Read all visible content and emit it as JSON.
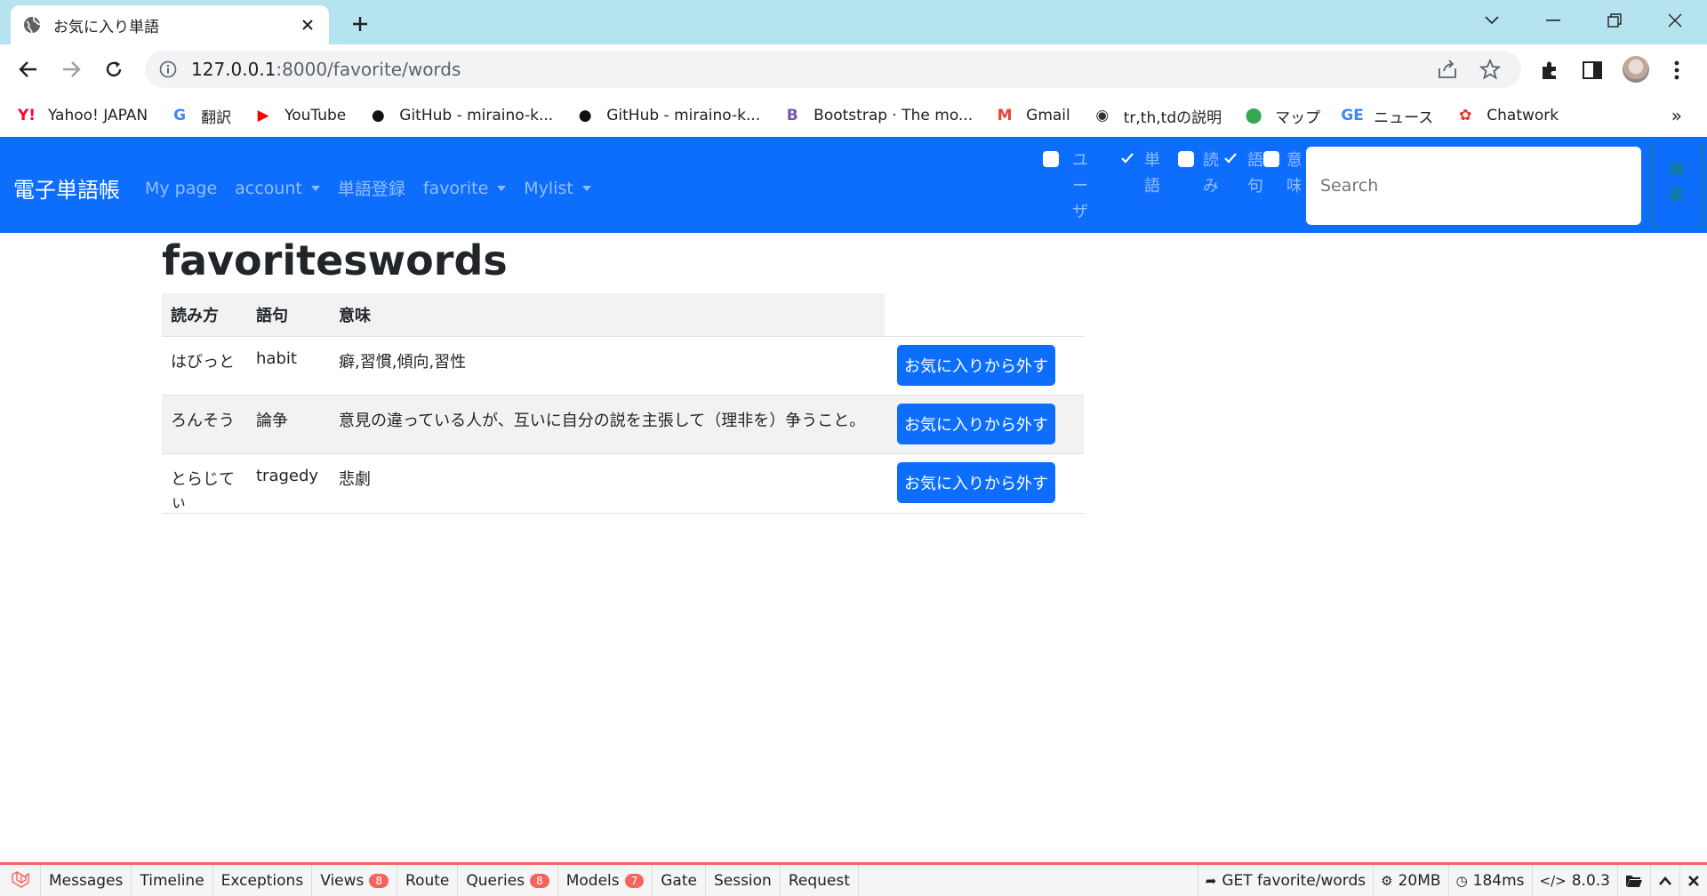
{
  "browser": {
    "tab_title": "お気に入り単語",
    "url_host": "127.0.0.1",
    "url_path": ":8000/favorite/words"
  },
  "bookmarks": [
    {
      "label": "Yahoo! JAPAN",
      "icon": "yahoo-icon",
      "glyph": "Y!",
      "color": "#ff0033"
    },
    {
      "label": "翻訳",
      "icon": "translate-icon",
      "glyph": "G",
      "color": "#4285f4"
    },
    {
      "label": "YouTube",
      "icon": "youtube-icon",
      "glyph": "▶",
      "color": "#ff0000"
    },
    {
      "label": "GitHub - miraino-k...",
      "icon": "github-icon",
      "glyph": "●",
      "color": "#111111"
    },
    {
      "label": "GitHub - miraino-k...",
      "icon": "github-icon",
      "glyph": "●",
      "color": "#111111"
    },
    {
      "label": "Bootstrap · The mo...",
      "icon": "bootstrap-icon",
      "glyph": "B",
      "color": "#7952b3"
    },
    {
      "label": "Gmail",
      "icon": "gmail-icon",
      "glyph": "M",
      "color": "#ea4335"
    },
    {
      "label": "tr,th,tdの説明",
      "icon": "globe-icon",
      "glyph": "◉",
      "color": "#333333"
    },
    {
      "label": "マップ",
      "icon": "maps-icon",
      "glyph": "⬤",
      "color": "#34a853"
    },
    {
      "label": "ニュース",
      "icon": "news-icon",
      "glyph": "GE",
      "color": "#4285f4"
    },
    {
      "label": "Chatwork",
      "icon": "chatwork-icon",
      "glyph": "✿",
      "color": "#e6332a"
    }
  ],
  "navbar": {
    "brand": "電子単語帳",
    "links": [
      "My page",
      "account",
      "単語登録",
      "favorite",
      "Mylist"
    ],
    "filters": {
      "user": {
        "label": "ユーザー名",
        "checked": false
      },
      "word": {
        "label": "単語",
        "checked": true
      },
      "reading": {
        "label": "読み",
        "checked": false
      },
      "phrase": {
        "label": "語句",
        "checked": true
      },
      "meaning": {
        "label": "意味",
        "checked": false
      }
    },
    "search_placeholder": "Search",
    "search_button": "検索"
  },
  "main": {
    "title": "favoriteswords",
    "columns": [
      "読み方",
      "語句",
      "意味"
    ],
    "rows": [
      {
        "reading": "はびっと",
        "phrase": "habit",
        "meaning": "癖,習慣,傾向,習性",
        "action": "お気に入りから外す"
      },
      {
        "reading": "ろんそう",
        "phrase": "論争",
        "meaning": "意見の違っている人が、互いに自分の説を主張して（理非を）争うこと。",
        "action": "お気に入りから外す"
      },
      {
        "reading": "とらじてぃ",
        "phrase": "tragedy",
        "meaning": "悲劇",
        "action": "お気に入りから外す"
      }
    ]
  },
  "debugbar": {
    "tabs": [
      {
        "label": "Messages"
      },
      {
        "label": "Timeline"
      },
      {
        "label": "Exceptions"
      },
      {
        "label": "Views",
        "badge": "8"
      },
      {
        "label": "Route"
      },
      {
        "label": "Queries",
        "badge": "8"
      },
      {
        "label": "Models",
        "badge": "7"
      },
      {
        "label": "Gate"
      },
      {
        "label": "Session"
      },
      {
        "label": "Request"
      }
    ],
    "route": "GET favorite/words",
    "memory": "20MB",
    "time": "184ms",
    "php_version": "8.0.3",
    "accent": "#f4645f"
  }
}
